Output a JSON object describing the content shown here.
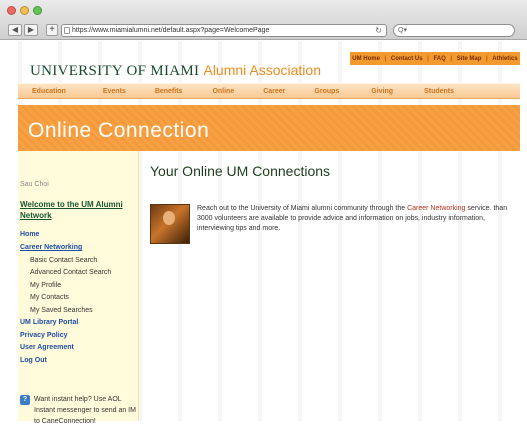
{
  "browser": {
    "url": "https://www.miamialumni.net/default.aspx?page=WelcomePage",
    "search_placeholder": "Q▾"
  },
  "site": {
    "logo_university": "UNIVERSITY OF MIAMI",
    "logo_association": "Alumni Association",
    "top_links": [
      "UM Home",
      "Contact Us",
      "FAQ",
      "Site Map",
      "Athletics"
    ],
    "nav": [
      "Education",
      "Events",
      "Benefits",
      "Online",
      "Career",
      "Groups",
      "Giving",
      "Students"
    ],
    "banner_title": "Online Connection"
  },
  "sidebar": {
    "user_name": "Sau Choi",
    "welcome": "Welcome to the UM Alumni Network",
    "links": {
      "home": "Home",
      "career": "Career Networking",
      "basic": "Basic Contact Search",
      "advanced": "Advanced Contact Search",
      "profile": "My Profile",
      "contacts": "My Contacts",
      "saved": "My Saved Searches",
      "library": "UM Library Portal",
      "privacy": "Privacy Policy",
      "agreement": "User Agreement",
      "logout": "Log Out"
    },
    "help_text": "Want instant help? Use AOL Instant messenger to send an IM to CaneConnection!"
  },
  "main": {
    "title": "Your Online UM Connections",
    "intro_before": "Reach out to the University of Miami alumni community through the ",
    "intro_link": "Career Networking",
    "intro_after": " service. than 3000 volunteers are available to provide advice and information on jobs, industry information, interviewing tips and more."
  },
  "colors": {
    "accent_orange": "#f18a1d",
    "brand_green": "#1a4a2e",
    "link_blue": "#1f4ea8"
  }
}
